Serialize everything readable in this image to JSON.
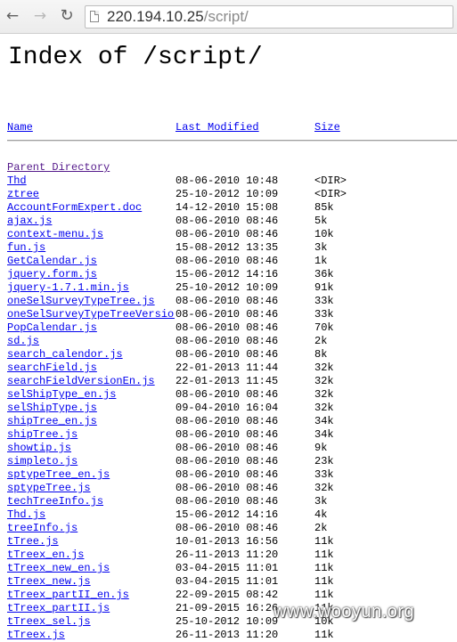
{
  "browser": {
    "url_host": "220.194.10.25",
    "url_path": "/script/"
  },
  "page": {
    "title": "Index of /script/",
    "headers": {
      "name": "Name",
      "modified": "Last Modified",
      "size": "Size"
    },
    "parent_label": "Parent Directory",
    "entries": [
      {
        "name": "Thd",
        "date": "08-06-2010 10:48",
        "size": "<DIR>"
      },
      {
        "name": "ztree",
        "date": "25-10-2012 10:09",
        "size": "<DIR>"
      },
      {
        "name": "AccountFormExpert.doc",
        "date": "14-12-2010 15:08",
        "size": "85k"
      },
      {
        "name": "ajax.js",
        "date": "08-06-2010 08:46",
        "size": "5k"
      },
      {
        "name": "context-menu.js",
        "date": "08-06-2010 08:46",
        "size": "10k"
      },
      {
        "name": "fun.js",
        "date": "15-08-2012 13:35",
        "size": "3k"
      },
      {
        "name": "GetCalendar.js",
        "date": "08-06-2010 08:46",
        "size": "1k"
      },
      {
        "name": "jquery.form.js",
        "date": "15-06-2012 14:16",
        "size": "36k"
      },
      {
        "name": "jquery-1.7.1.min.js",
        "date": "25-10-2012 10:09",
        "size": "91k"
      },
      {
        "name": "oneSelSurveyTypeTree.js",
        "date": "08-06-2010 08:46",
        "size": "33k"
      },
      {
        "name": "oneSelSurveyTypeTreeVersionEn.js",
        "date": "08-06-2010 08:46",
        "size": "33k"
      },
      {
        "name": "PopCalendar.js",
        "date": "08-06-2010 08:46",
        "size": "70k"
      },
      {
        "name": "sd.js",
        "date": "08-06-2010 08:46",
        "size": "2k"
      },
      {
        "name": "search_calendor.js",
        "date": "08-06-2010 08:46",
        "size": "8k"
      },
      {
        "name": "searchField.js",
        "date": "22-01-2013 11:44",
        "size": "32k"
      },
      {
        "name": "searchFieldVersionEn.js",
        "date": "22-01-2013 11:45",
        "size": "32k"
      },
      {
        "name": "selShipType_en.js",
        "date": "08-06-2010 08:46",
        "size": "32k"
      },
      {
        "name": "selShipType.js",
        "date": "09-04-2010 16:04",
        "size": "32k"
      },
      {
        "name": "shipTree_en.js",
        "date": "08-06-2010 08:46",
        "size": "34k"
      },
      {
        "name": "shipTree.js",
        "date": "08-06-2010 08:46",
        "size": "34k"
      },
      {
        "name": "showtip.js",
        "date": "08-06-2010 08:46",
        "size": "9k"
      },
      {
        "name": "simpleto.js",
        "date": "08-06-2010 08:46",
        "size": "23k"
      },
      {
        "name": "sptypeTree_en.js",
        "date": "08-06-2010 08:46",
        "size": "33k"
      },
      {
        "name": "sptypeTree.js",
        "date": "08-06-2010 08:46",
        "size": "32k"
      },
      {
        "name": "techTreeInfo.js",
        "date": "08-06-2010 08:46",
        "size": "3k"
      },
      {
        "name": "Thd.js",
        "date": "15-06-2012 14:16",
        "size": "4k"
      },
      {
        "name": "treeInfo.js",
        "date": "08-06-2010 08:46",
        "size": "2k"
      },
      {
        "name": "tTree.js",
        "date": "10-01-2013 16:56",
        "size": "11k"
      },
      {
        "name": "tTreex_en.js",
        "date": "26-11-2013 11:20",
        "size": "11k"
      },
      {
        "name": "tTreex_new_en.js",
        "date": "03-04-2015 11:01",
        "size": "11k"
      },
      {
        "name": "tTreex_new.js",
        "date": "03-04-2015 11:01",
        "size": "11k"
      },
      {
        "name": "tTreex_partII_en.js",
        "date": "22-09-2015 08:42",
        "size": "11k"
      },
      {
        "name": "tTreex_partII.js",
        "date": "21-09-2015 16:26",
        "size": "11k"
      },
      {
        "name": "tTreex_sel.js",
        "date": "25-10-2012 10:09",
        "size": "10k"
      },
      {
        "name": "tTreex.js",
        "date": "26-11-2013 11:20",
        "size": "11k"
      }
    ]
  },
  "watermark": "www.wooyun.org"
}
